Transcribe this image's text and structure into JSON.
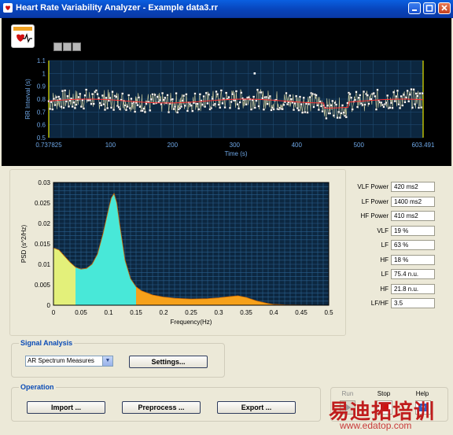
{
  "window": {
    "title": "Heart Rate Variability Analyzer - Example data3.rr",
    "controls": [
      "minimize",
      "maximize",
      "close"
    ]
  },
  "rr_plot": {
    "ylabel": "RR Interval (s)",
    "xlabel": "Time (s)",
    "x_start": "0.737825",
    "x_end": "603.491",
    "x_ticks": [
      "0.737825",
      "100",
      "200",
      "300",
      "400",
      "500",
      "603.491"
    ],
    "y_ticks": [
      "1.1",
      "1",
      "0.9",
      "0.8",
      "0.7",
      "0.6",
      "0.5"
    ],
    "tool_icons": [
      "crosshair-icon",
      "zoom-icon",
      "pan-hand-icon"
    ]
  },
  "chart_data": {
    "type": "area",
    "xlabel": "Frequency(Hz)",
    "ylabel": "PSD (s^2/Hz)",
    "xlim": [
      0,
      0.5
    ],
    "ylim": [
      0,
      0.03
    ],
    "x_ticks": [
      "0",
      "0.05",
      "0.1",
      "0.15",
      "0.2",
      "0.25",
      "0.3",
      "0.35",
      "0.4",
      "0.45",
      "0.5"
    ],
    "y_ticks": [
      "0.03",
      "0.025",
      "0.02",
      "0.015",
      "0.01",
      "0.005",
      "0"
    ],
    "x": [
      0,
      0.01,
      0.02,
      0.03,
      0.04,
      0.05,
      0.06,
      0.07,
      0.08,
      0.09,
      0.1,
      0.105,
      0.11,
      0.115,
      0.12,
      0.13,
      0.14,
      0.15,
      0.16,
      0.18,
      0.2,
      0.22,
      0.25,
      0.28,
      0.3,
      0.32,
      0.335,
      0.35,
      0.37,
      0.39,
      0.4,
      0.42,
      0.45,
      0.5
    ],
    "y": [
      0.014,
      0.0135,
      0.012,
      0.0105,
      0.0093,
      0.0088,
      0.009,
      0.01,
      0.0125,
      0.0175,
      0.0235,
      0.0262,
      0.0273,
      0.025,
      0.02,
      0.011,
      0.0065,
      0.0045,
      0.0035,
      0.0025,
      0.002,
      0.0017,
      0.0015,
      0.0016,
      0.0018,
      0.0021,
      0.0023,
      0.0019,
      0.001,
      0.0004,
      0.0002,
      0.0001,
      5e-05,
      0
    ],
    "bands": [
      {
        "name": "VLF",
        "range": [
          0,
          0.04
        ],
        "color": "#e3f07a"
      },
      {
        "name": "LF",
        "range": [
          0.04,
          0.15
        ],
        "color": "#48e8d8"
      },
      {
        "name": "HF",
        "range": [
          0.15,
          0.4
        ],
        "color": "#f6a11a"
      }
    ]
  },
  "stats": [
    {
      "label": "VLF Power",
      "value": "420 ms2"
    },
    {
      "label": "LF Power",
      "value": "1400 ms2"
    },
    {
      "label": "HF Power",
      "value": "410 ms2"
    },
    {
      "label": "VLF",
      "value": "19 %"
    },
    {
      "label": "LF",
      "value": "63 %"
    },
    {
      "label": "HF",
      "value": "18 %"
    },
    {
      "label": "LF",
      "value": "75.4 n.u."
    },
    {
      "label": "HF",
      "value": "21.8 n.u."
    },
    {
      "label": "LF/HF",
      "value": "3.5"
    }
  ],
  "signal_analysis": {
    "title": "Signal Analysis",
    "method_selected": "AR Spectrum Measures",
    "settings_label": "Settings..."
  },
  "operation": {
    "title": "Operation",
    "import_label": "Import ...",
    "preprocess_label": "Preprocess ...",
    "export_label": "Export ..."
  },
  "toolbar": {
    "run_label": "Run",
    "stop_label": "Stop",
    "help_label": "Help"
  },
  "watermark": {
    "text": "易迪拓培训",
    "url": "www.edatop.com"
  },
  "colors": {
    "title_bar": "#0842b8",
    "plot_bg": "#0c2740",
    "grid": "#2a5f8c",
    "accent_blue": "#0b4cb6",
    "vlf": "#e3f07a",
    "lf": "#48e8d8",
    "hf": "#f6a11a"
  }
}
